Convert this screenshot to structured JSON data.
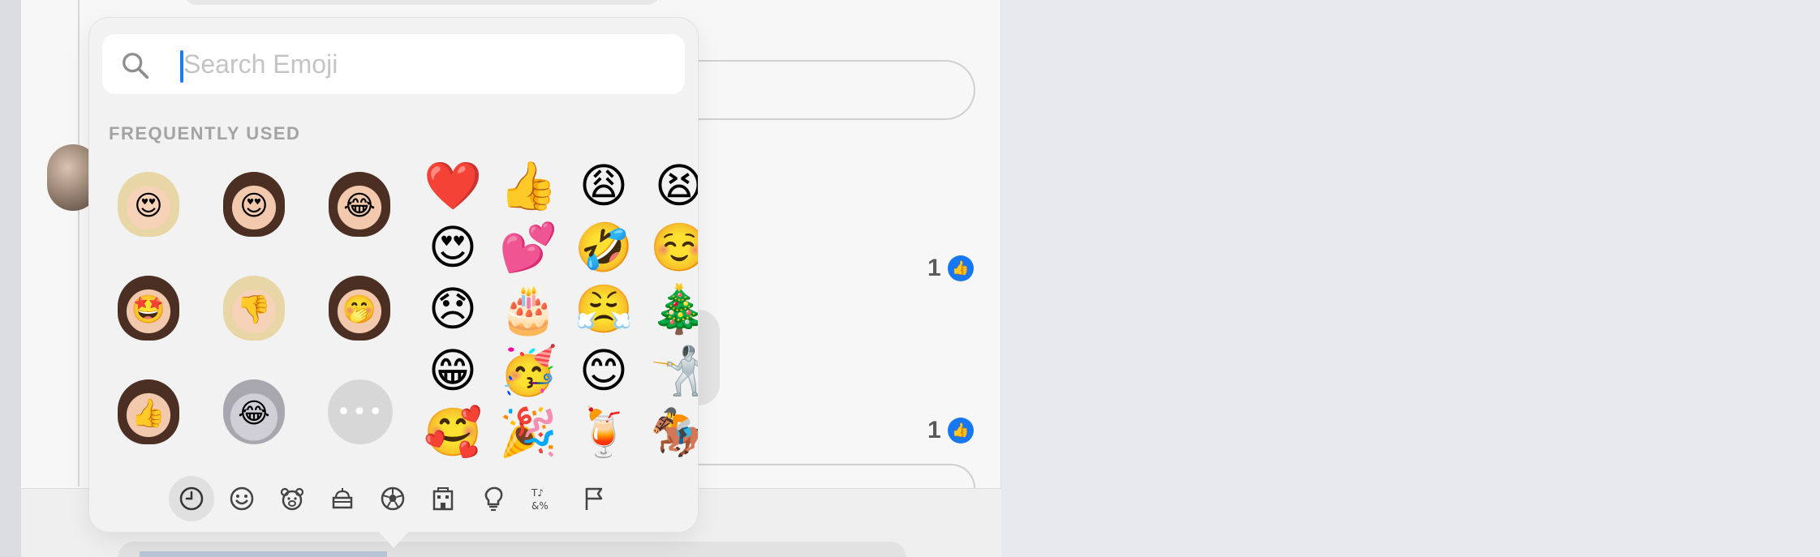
{
  "search": {
    "placeholder": "Search Emoji"
  },
  "picker": {
    "section_title": "FREQUENTLY USED",
    "memojis": [
      {
        "name": "memoji-blonde-heart-eyes",
        "emote": "😍"
      },
      {
        "name": "memoji-brunette-heart-eyes",
        "emote": "😍"
      },
      {
        "name": "memoji-brunette-tears-of-joy",
        "emote": "😂"
      },
      {
        "name": "memoji-brunette-star-struck",
        "emote": "🤩"
      },
      {
        "name": "memoji-blonde-thumbs-down",
        "emote": "👎"
      },
      {
        "name": "memoji-brunette-hand-over-mouth",
        "emote": "🤭"
      },
      {
        "name": "memoji-brunette-thumbs-up",
        "emote": "👍"
      },
      {
        "name": "memoji-mouse-tears-of-joy",
        "emote": "😂"
      }
    ],
    "more_button_label": "•••",
    "emojis": [
      "❤️",
      "👍",
      "😩",
      "😫",
      "😍",
      "💕",
      "🤣",
      "☺️",
      "😞",
      "🎂",
      "😤",
      "🎄",
      "😁",
      "🥳",
      "😊",
      "🤺",
      "🥰",
      "🎉",
      "🍹",
      "🏇"
    ],
    "categories": [
      {
        "name": "recent",
        "icon": "clock-icon",
        "active": true
      },
      {
        "name": "smileys",
        "icon": "smiley-icon",
        "active": false
      },
      {
        "name": "animals",
        "icon": "bear-icon",
        "active": false
      },
      {
        "name": "food",
        "icon": "food-icon",
        "active": false
      },
      {
        "name": "activity",
        "icon": "ball-icon",
        "active": false
      },
      {
        "name": "travel",
        "icon": "building-icon",
        "active": false
      },
      {
        "name": "objects",
        "icon": "lightbulb-icon",
        "active": false
      },
      {
        "name": "symbols",
        "icon": "symbols-icon",
        "active": false
      },
      {
        "name": "flags",
        "icon": "flag-icon",
        "active": false
      }
    ]
  },
  "background": {
    "likes": [
      {
        "count": "1"
      },
      {
        "count": "1"
      }
    ]
  },
  "colors": {
    "accent": "#1e7cf0",
    "like_blue": "#1877f2"
  }
}
